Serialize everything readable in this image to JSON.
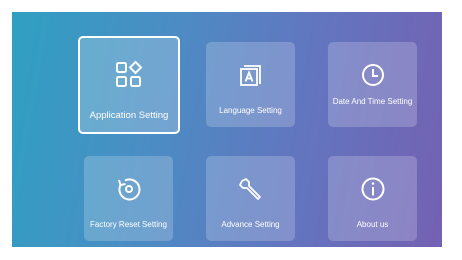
{
  "settings_menu": {
    "tiles": [
      {
        "label": "Application Setting",
        "icon": "apps-grid-icon",
        "selected": true
      },
      {
        "label": "Language Setting",
        "icon": "language-icon",
        "selected": false
      },
      {
        "label": "Date And Time Setting",
        "icon": "clock-icon",
        "selected": false
      },
      {
        "label": "Factory Reset Setting",
        "icon": "factory-reset-icon",
        "selected": false
      },
      {
        "label": "Advance Setting",
        "icon": "wrench-icon",
        "selected": false
      },
      {
        "label": "About us",
        "icon": "info-icon",
        "selected": false
      }
    ]
  },
  "colors": {
    "background_gradient_start": "#2fa0c2",
    "background_gradient_end": "#7461b3",
    "tile_text": "#ffffff",
    "selected_border": "#ffffff"
  }
}
